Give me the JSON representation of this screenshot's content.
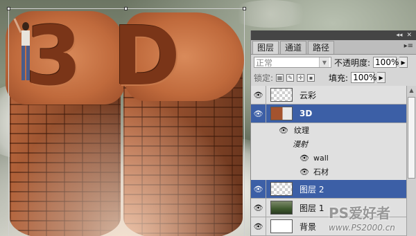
{
  "canvas": {
    "art_text": "3D",
    "figure": "person-figure"
  },
  "panel": {
    "top_controls": [
      "◂◂",
      "✕"
    ],
    "tabs": [
      {
        "label": "图层",
        "active": true
      },
      {
        "label": "通道",
        "active": false
      },
      {
        "label": "路径",
        "active": false
      }
    ],
    "menu_icon": "panel-menu-icon",
    "blend_mode": "正常",
    "opacity_label": "不透明度:",
    "opacity_value": "100%",
    "lock_label": "锁定:",
    "fill_label": "填充:",
    "fill_value": "100%",
    "layers": [
      {
        "name": "云彩",
        "thumb": "checker",
        "selected": false
      },
      {
        "name": "3D",
        "thumb": "3d",
        "selected": true
      },
      {
        "name": "图层 2",
        "thumb": "checker",
        "selected": true
      },
      {
        "name": "图层 1",
        "thumb": "landscape",
        "selected": false
      },
      {
        "name": "背景",
        "thumb": "white",
        "selected": false
      }
    ],
    "sublayers": {
      "texture": "纹理",
      "diffuse": "漫射",
      "wall": "wall",
      "stone": "石材"
    },
    "selected_color": "#3c5fa6"
  },
  "watermark": {
    "logo": "PS爱好者",
    "url": "www.PS2000.cn"
  }
}
